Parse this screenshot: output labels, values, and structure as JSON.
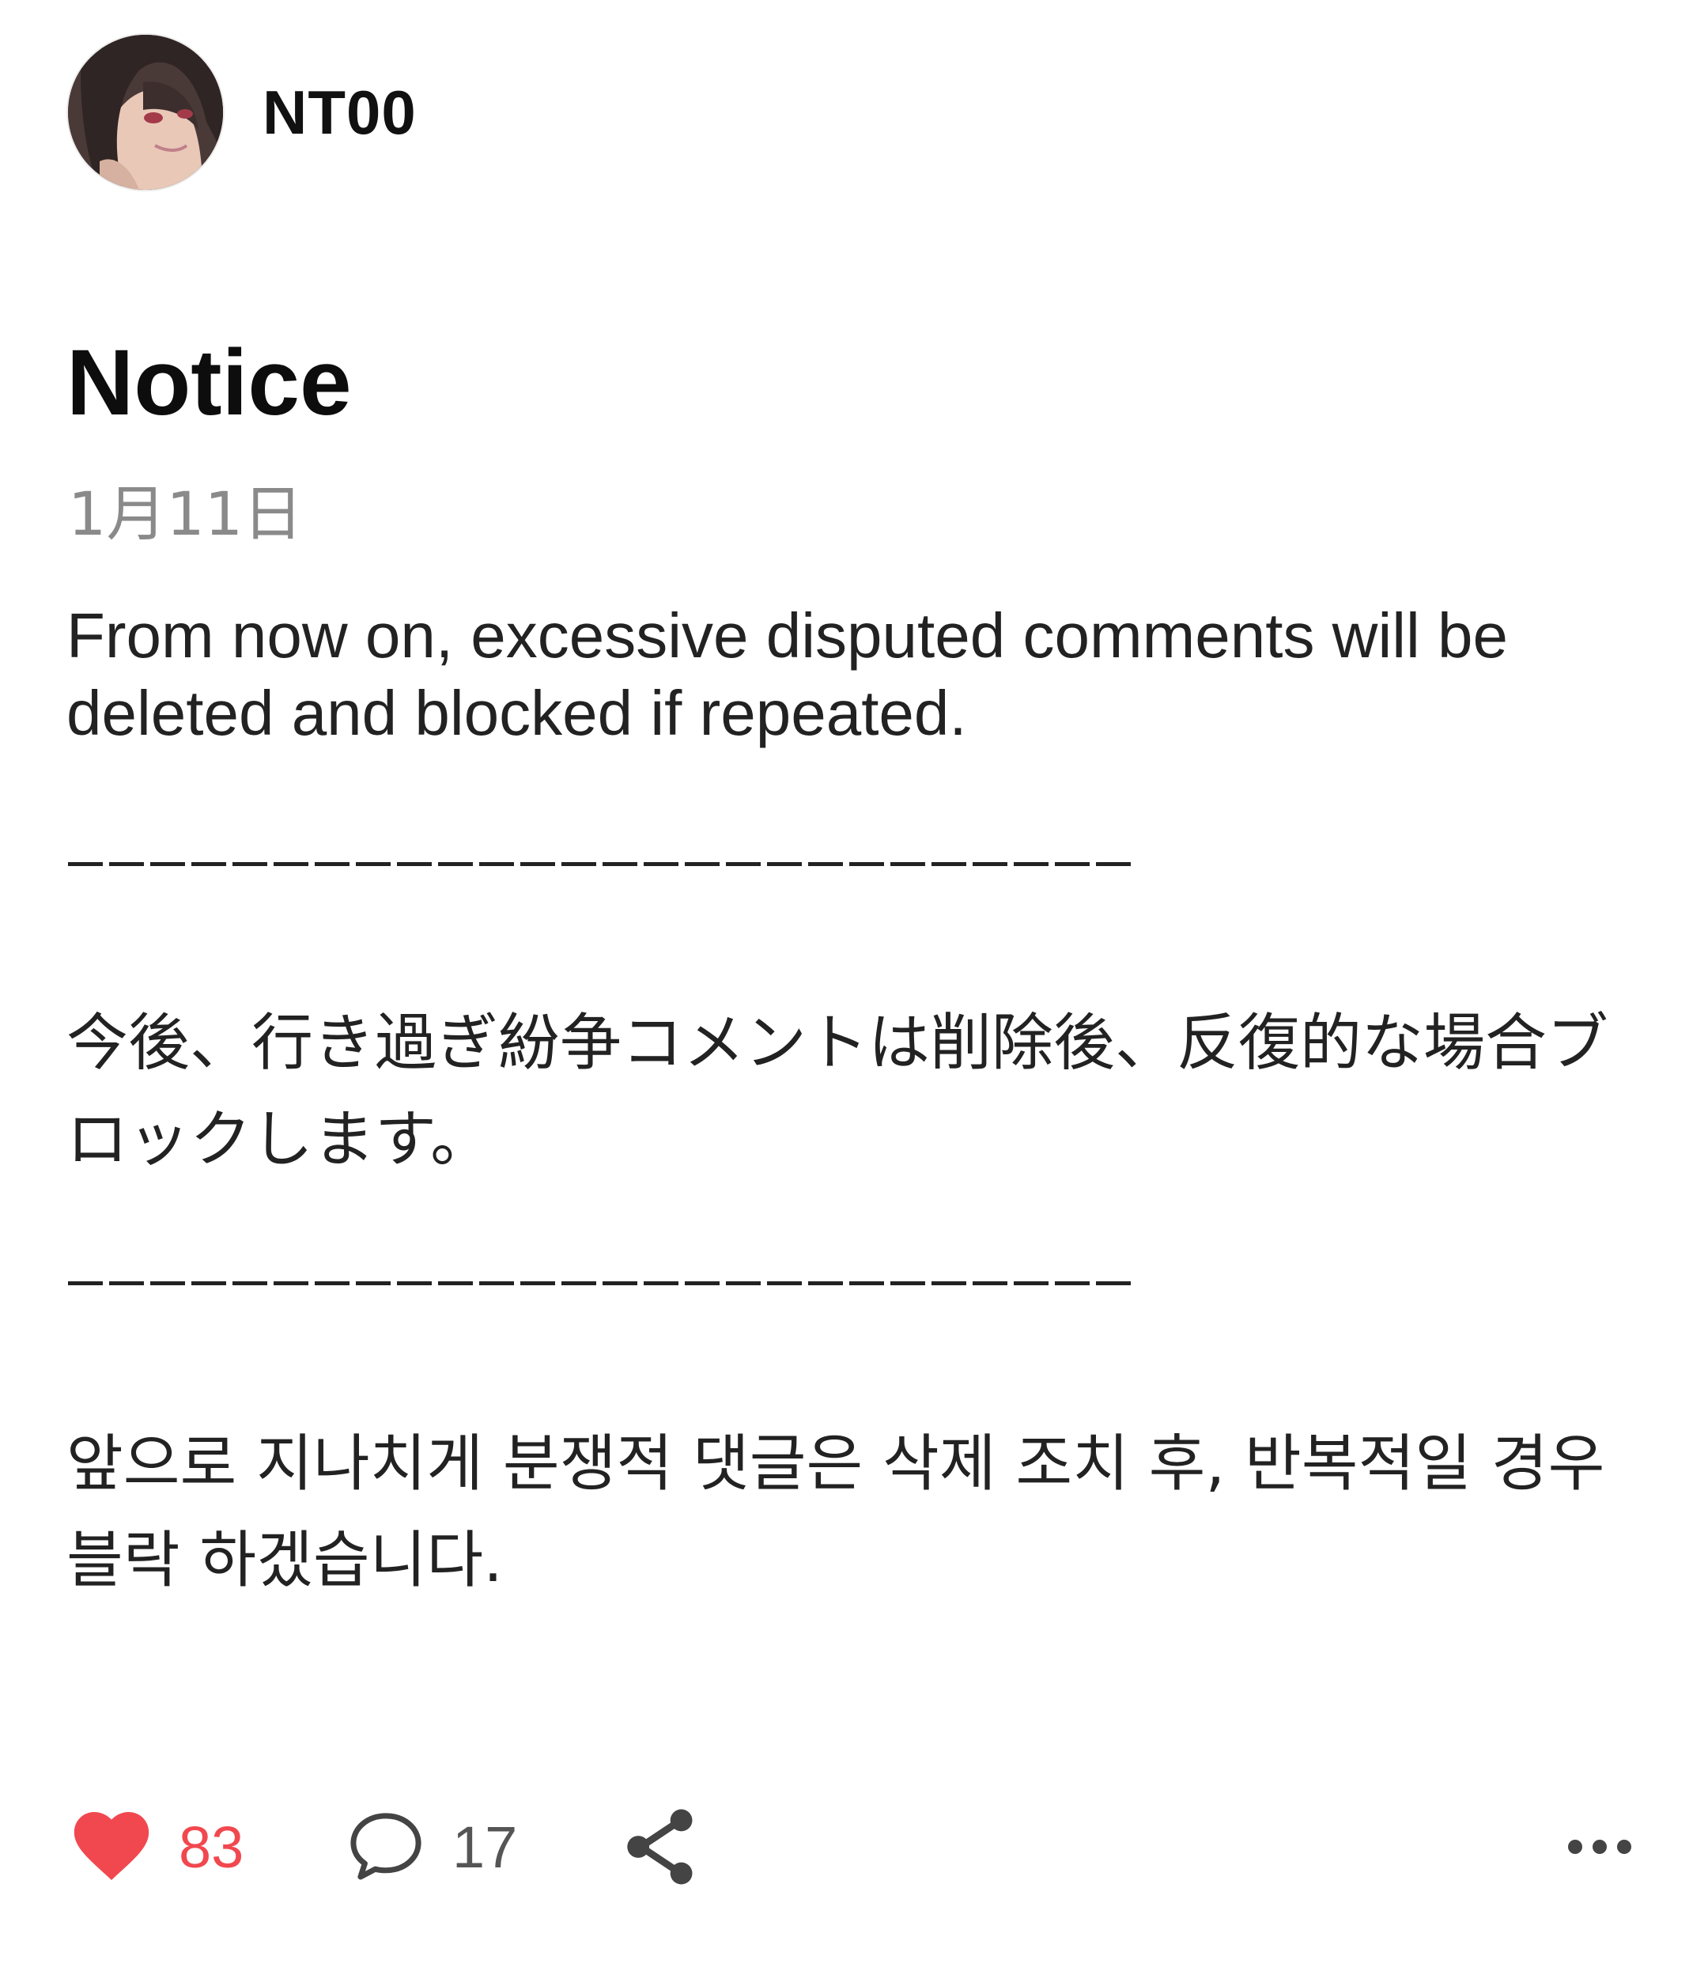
{
  "post": {
    "author": {
      "name": "NT00",
      "avatar_icon": "anime-girl-avatar"
    },
    "title": "Notice",
    "date": "1月11日",
    "paragraphs": {
      "english": "From now on, excessive disputed comments will be deleted and blocked if repeated.",
      "separator_1": "————————————————————————",
      "japanese": "今後、行き過ぎ紛争コメントは削除後、反復的な場合ブロックします。",
      "separator_2": "————————————————————————",
      "korean": "앞으로 지나치게 분쟁적 댓글은 삭제 조치 후, 반복적일 경우 블락 하겠습니다."
    },
    "actions": {
      "like_icon": "heart-icon",
      "like_count": "83",
      "like_color": "#f1484f",
      "comment_icon": "comment-bubble-icon",
      "comment_count": "17",
      "share_icon": "share-icon",
      "more_icon": "more-dots-icon"
    }
  }
}
